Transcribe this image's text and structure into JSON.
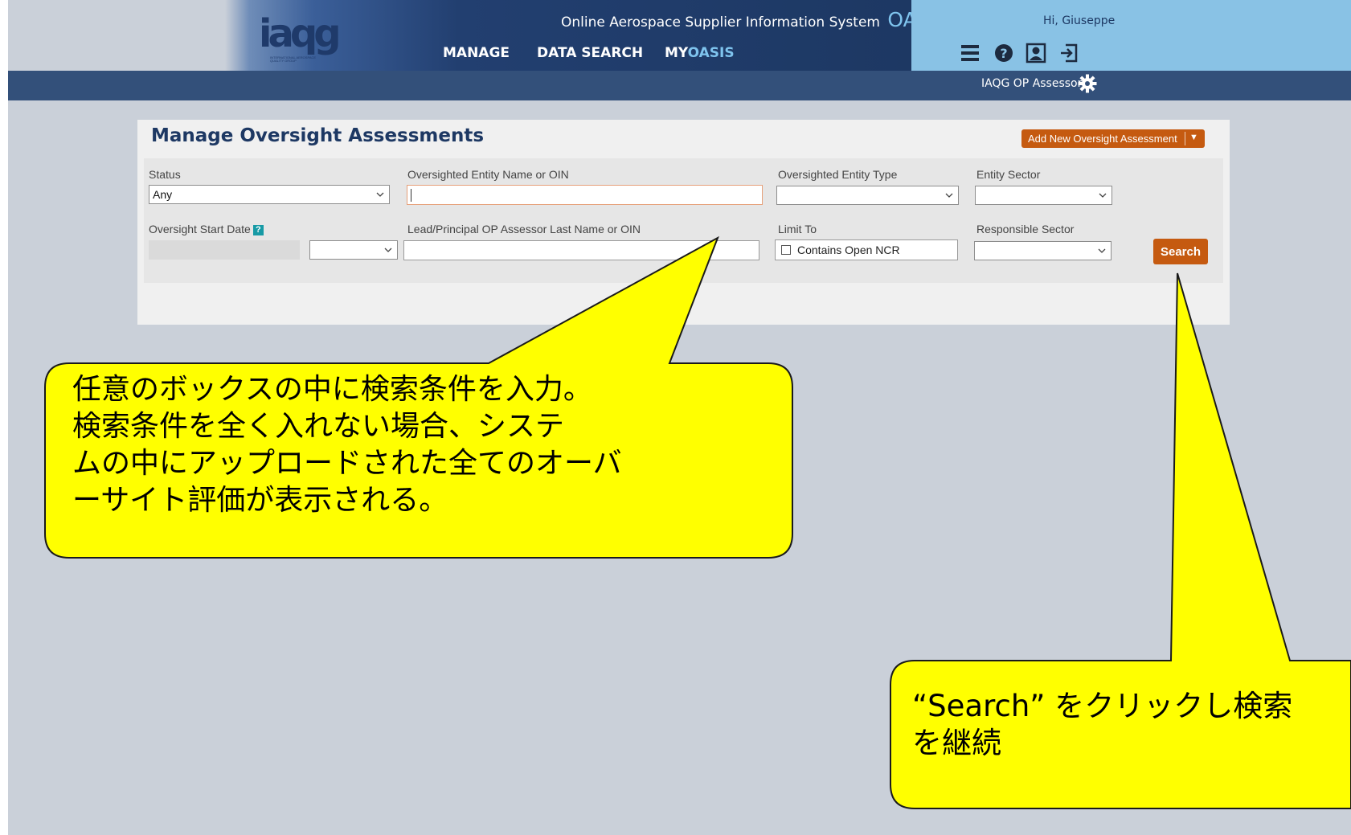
{
  "header": {
    "logo_text": "iaqg",
    "logo_subtext": "INTERNATIONAL AEROSPACE QUALITY GROUP",
    "system_title": "Online Aerospace Supplier Information System",
    "system_acronym": "OASIS",
    "nav": [
      {
        "label": "MANAGE"
      },
      {
        "label": "DATA SEARCH"
      },
      {
        "label_prefix": "MY",
        "label_accent": "OASIS"
      }
    ],
    "greeting": "Hi, Giuseppe",
    "icons": [
      "menu-icon",
      "help-icon",
      "profile-icon",
      "logout-icon"
    ],
    "role": "IAQG OP Assessor",
    "role_icon": "gear-icon"
  },
  "panel": {
    "title": "Manage Oversight Assessments",
    "add_button": "Add New Oversight Assessment",
    "filters": {
      "status_label": "Status",
      "status_value": "Any",
      "entity_name_label": "Oversighted Entity Name or OIN",
      "entity_name_value": "",
      "entity_type_label": "Oversighted Entity Type",
      "entity_type_value": "",
      "entity_sector_label": "Entity Sector",
      "entity_sector_value": "",
      "start_date_label": "Oversight Start Date",
      "start_date_help": "?",
      "start_date_value": "",
      "assessor_label": "Lead/Principal OP Assessor Last Name or OIN",
      "assessor_value": "",
      "limit_to_label": "Limit To",
      "limit_to_option": "Contains Open NCR",
      "limit_to_checked": false,
      "responsible_sector_label": "Responsible Sector",
      "responsible_sector_value": ""
    },
    "search_button": "Search"
  },
  "callouts": {
    "left_lines": [
      "任意のボックスの中に検索条件を入力。",
      "検索条件を全く入れない場合、システ",
      "ムの中にアップロードされた全てのオーバ",
      "ーサイト評価が表示される。"
    ],
    "right_lines": [
      "“Search” をクリックし検索",
      "を継続"
    ]
  },
  "colors": {
    "header_dark": "#1d3863",
    "header_light": "#89c2e5",
    "subbar": "#33507a",
    "accent_orange": "#c55a10",
    "background": "#cad0d9",
    "callout_yellow": "#ffff00"
  }
}
